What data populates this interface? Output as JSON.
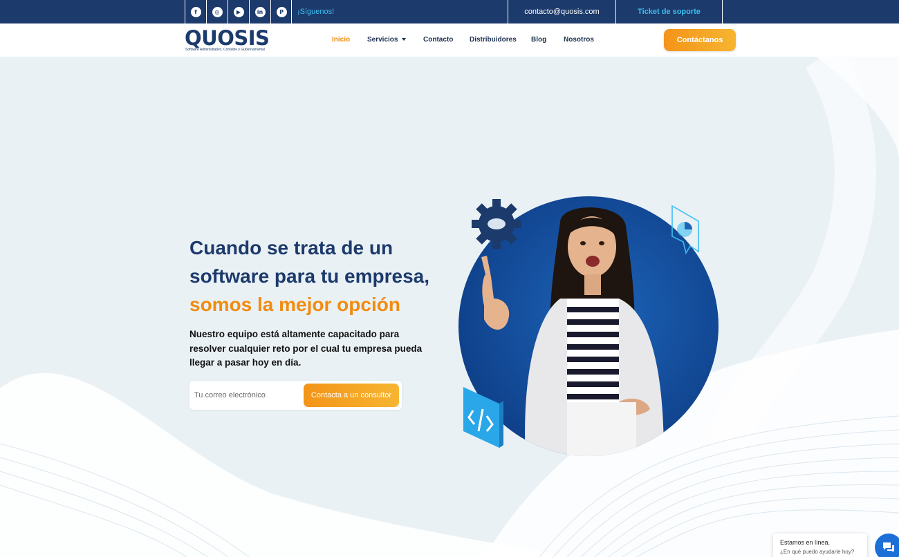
{
  "topbar": {
    "social": [
      {
        "name": "facebook-icon",
        "glyph": "f"
      },
      {
        "name": "instagram-icon",
        "glyph": "◎"
      },
      {
        "name": "youtube-icon",
        "glyph": "▶"
      },
      {
        "name": "linkedin-icon",
        "glyph": "in"
      },
      {
        "name": "pinterest-icon",
        "glyph": "P"
      }
    ],
    "follow_label": "¡Síguenos!",
    "email": "contacto@quosis.com",
    "ticket_label": "Ticket de soporte"
  },
  "nav": {
    "logo_text": "QUOSIS",
    "logo_tagline": "Software Administrativo, Contable y Gubernamental",
    "items": [
      "Inicio",
      "Servicios",
      "Contacto",
      "Distribuidores",
      "Blog",
      "Nosotros"
    ],
    "active_item": "Inicio",
    "cta_label": "Contáctanos"
  },
  "hero": {
    "title_line1": "Cuando se trata de un",
    "title_line2": "software para tu empresa,",
    "title_accent": "somos la mejor opción",
    "description": "Nuestro equipo está altamente capacitado para resolver cualquier reto por el cual tu empresa pueda llegar a pasar hoy en día.",
    "email_placeholder": "Tu correo electrónico",
    "submit_label": "Contacta a un consultor"
  },
  "chat": {
    "status": "Estamos en línea.",
    "prompt": "¿En qué puedo ayudarle hoy?"
  },
  "colors": {
    "primary": "#1c3a6b",
    "accent": "#f08c10",
    "light_blue": "#3cc0f2",
    "background": "#eaf1f5"
  }
}
